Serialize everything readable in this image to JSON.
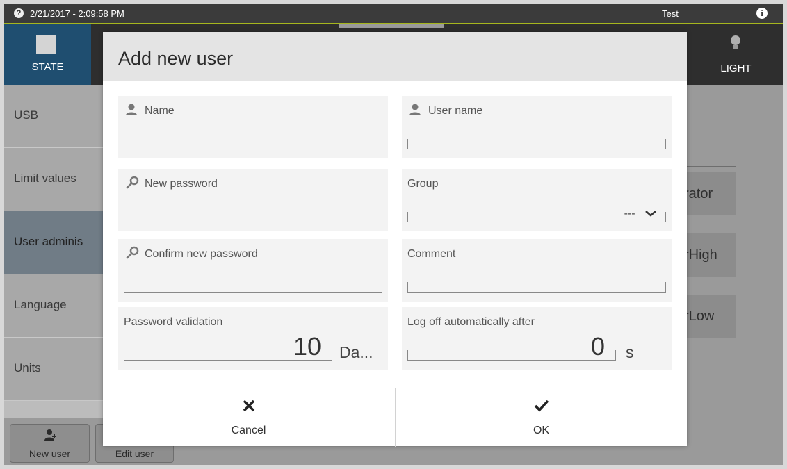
{
  "status": {
    "datetime": "2/21/2017 - 2:09:58 PM",
    "product": "Test"
  },
  "nav": {
    "state_label": "STATE",
    "light_label": "LIGHT"
  },
  "sidebar": {
    "items": [
      {
        "label": "USB"
      },
      {
        "label": "Limit values"
      },
      {
        "label": "User adminis"
      },
      {
        "label": "Language"
      },
      {
        "label": "Units"
      }
    ]
  },
  "background_table": {
    "cells": [
      "rator",
      "rHigh",
      "rLow"
    ]
  },
  "toolbar": {
    "new_user": "New user",
    "edit_user": "Edit user"
  },
  "modal": {
    "title": "Add new user",
    "fields": {
      "name": {
        "label": "Name",
        "value": ""
      },
      "username": {
        "label": "User name",
        "value": ""
      },
      "new_password": {
        "label": "New password",
        "value": ""
      },
      "group": {
        "label": "Group",
        "value": "---"
      },
      "confirm_password": {
        "label": "Confirm new password",
        "value": ""
      },
      "comment": {
        "label": "Comment",
        "value": ""
      },
      "password_validation": {
        "label": "Password validation",
        "value": "10",
        "unit": "Da..."
      },
      "logoff": {
        "label": "Log off automatically after",
        "value": "0",
        "unit": "s"
      }
    },
    "buttons": {
      "cancel": "Cancel",
      "ok": "OK"
    }
  },
  "icons": {
    "help": "help-icon",
    "info": "info-icon",
    "state": "state-square-icon",
    "light": "light-bulb-icon",
    "user": "user-icon",
    "key": "key-icon",
    "chevron": "chevron-down-icon",
    "cancel": "x-icon",
    "ok": "check-icon"
  },
  "colors": {
    "status_bar": "#3b3b3b",
    "accent_line": "#a6b61e",
    "state_tab": "#1f4e70",
    "active_sidebar": "#707c86"
  }
}
